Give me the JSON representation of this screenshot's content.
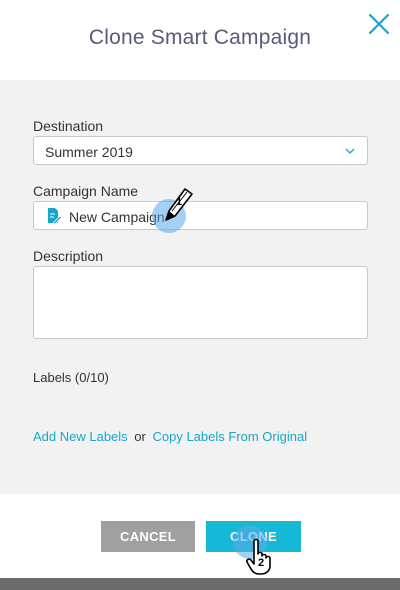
{
  "dialog": {
    "title": "Clone Smart Campaign",
    "close_icon": "close-icon"
  },
  "form": {
    "destination_label": "Destination",
    "destination_value": "Summer 2019",
    "campaign_name_label": "Campaign Name",
    "campaign_name_value": "New Campaign",
    "description_label": "Description",
    "description_value": "",
    "labels_text": "Labels (0/10)",
    "add_labels_link": "Add New Labels",
    "or_text": "or",
    "copy_labels_link": "Copy Labels From Original"
  },
  "footer": {
    "cancel_label": "CANCEL",
    "clone_label": "CLONE"
  },
  "annotations": {
    "step1": "1",
    "step2": "2"
  },
  "colors": {
    "title": "#575a78",
    "accent": "#15b8d6",
    "link": "#19a5c7",
    "cancel": "#a0a0a0"
  }
}
